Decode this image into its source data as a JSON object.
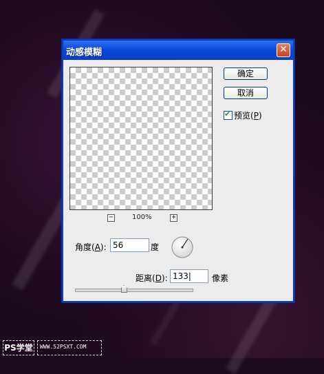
{
  "dialog": {
    "title": "动感模糊",
    "close_glyph": "✕",
    "ok_label": "确定",
    "cancel_label": "取消",
    "preview_label": "预览",
    "preview_key": "P",
    "preview_checked": true,
    "zoom_out_glyph": "−",
    "zoom_in_glyph": "+",
    "zoom_level": "100%",
    "angle_label": "角度",
    "angle_key": "A",
    "angle_value": "56",
    "angle_unit": "度",
    "distance_label": "距离",
    "distance_key": "D",
    "distance_value": "133",
    "distance_unit": "像素",
    "distance_slider_fraction": 0.42
  },
  "watermark": {
    "left_text": "PS学堂",
    "right_text": "WWW.52PSXT.COM"
  },
  "colors": {
    "titlebar": "#0b46d8",
    "dialog_bg": "#ececec",
    "background": "#1e0a1f"
  }
}
